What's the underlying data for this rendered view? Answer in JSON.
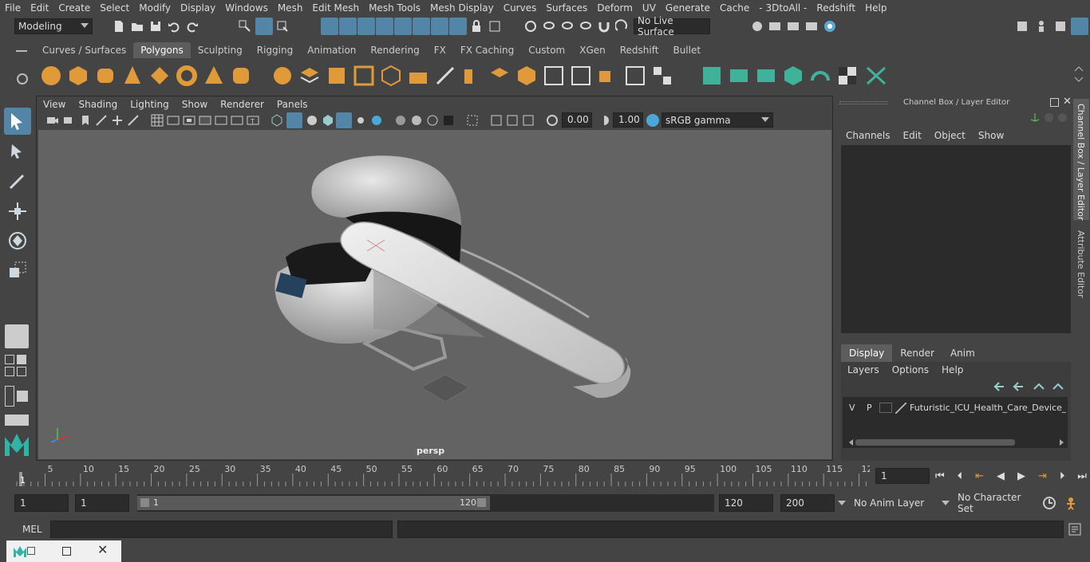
{
  "menubar": {
    "items": [
      "File",
      "Edit",
      "Create",
      "Select",
      "Modify",
      "Display",
      "Windows",
      "Mesh",
      "Edit Mesh",
      "Mesh Tools",
      "Mesh Display",
      "Curves",
      "Surfaces",
      "Deform",
      "UV",
      "Generate",
      "Cache",
      "- 3DtoAll -",
      "Redshift",
      "Help"
    ]
  },
  "statusline": {
    "workspace": "Modeling",
    "live_surface": "No Live Surface"
  },
  "shelf": {
    "tabs": [
      "Curves / Surfaces",
      "Polygons",
      "Sculpting",
      "Rigging",
      "Animation",
      "Rendering",
      "FX",
      "FX Caching",
      "Custom",
      "XGen",
      "Redshift",
      "Bullet"
    ],
    "active_tab": "Polygons"
  },
  "viewport": {
    "menu": [
      "View",
      "Shading",
      "Lighting",
      "Show",
      "Renderer",
      "Panels"
    ],
    "exposure": "0.00",
    "gamma": "1.00",
    "colorspace": "sRGB gamma",
    "camera_label": "persp"
  },
  "channel_box": {
    "title": "Channel Box / Layer Editor",
    "menu": [
      "Channels",
      "Edit",
      "Object",
      "Show"
    ],
    "layer_tabs": [
      "Display",
      "Render",
      "Anim"
    ],
    "active_layer_tab": "Display",
    "layer_menu": [
      "Layers",
      "Options",
      "Help"
    ],
    "layer": {
      "v": "V",
      "p": "P",
      "name": "Futuristic_ICU_Health_Care_Device_Wh"
    }
  },
  "side_tabs": {
    "channel_box": "Channel Box / Layer Editor",
    "attribute_editor": "Attribute Editor"
  },
  "timeline": {
    "ticks": [
      "1",
      "5",
      "10",
      "15",
      "20",
      "25",
      "30",
      "35",
      "40",
      "45",
      "50",
      "55",
      "60",
      "65",
      "70",
      "75",
      "80",
      "85",
      "90",
      "95",
      "100",
      "105",
      "110",
      "115",
      "12"
    ],
    "current_frame": "1"
  },
  "range": {
    "start": "1",
    "current": "1",
    "slider_start": "1",
    "slider_end": "120",
    "end": "120",
    "max_end": "200",
    "anim_layer": "No Anim Layer",
    "character_set": "No Character Set"
  },
  "command_line": {
    "label": "MEL"
  },
  "colors": {
    "accent_blue": "#5285a6",
    "shelf_orange": "#e09a3a",
    "shelf_teal": "#3fb39a"
  }
}
